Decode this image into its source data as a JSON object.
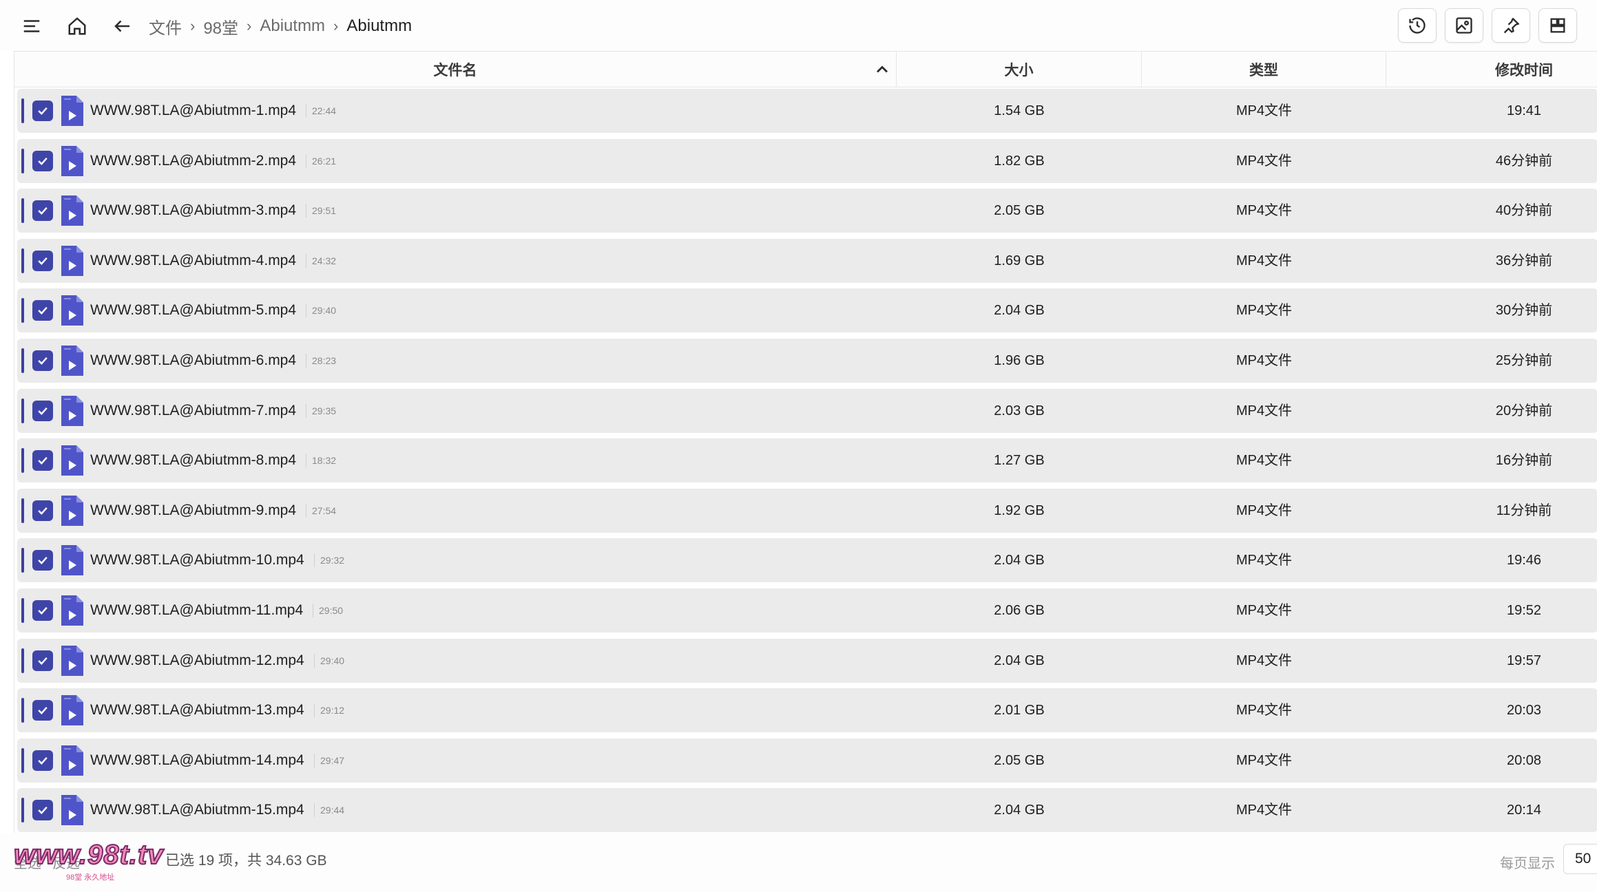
{
  "breadcrumb": {
    "items": [
      "文件",
      "98堂",
      "Abiutmm",
      "Abiutmm"
    ]
  },
  "icons": {
    "menu": "hamburger-menu-icon",
    "home": "home-icon",
    "back": "arrow-left-icon",
    "history": "history-icon",
    "image": "image-icon",
    "pin": "pin-icon",
    "layout": "layout-grid-icon"
  },
  "colors": {
    "checkbox": "#3f45a8",
    "row_bg": "#ebebeb",
    "file_icon": "#4f55c9"
  },
  "table": {
    "columns": {
      "name": "文件名",
      "size": "大小",
      "type": "类型",
      "time": "修改时间"
    },
    "sort": {
      "column": "name",
      "direction": "asc"
    },
    "rows": [
      {
        "name": "WWW.98T.LA@Abiutmm-1.mp4",
        "duration": "22:44",
        "size": "1.54 GB",
        "type": "MP4文件",
        "time": "19:41",
        "checked": true
      },
      {
        "name": "WWW.98T.LA@Abiutmm-2.mp4",
        "duration": "26:21",
        "size": "1.82 GB",
        "type": "MP4文件",
        "time": "46分钟前",
        "checked": true
      },
      {
        "name": "WWW.98T.LA@Abiutmm-3.mp4",
        "duration": "29:51",
        "size": "2.05 GB",
        "type": "MP4文件",
        "time": "40分钟前",
        "checked": true
      },
      {
        "name": "WWW.98T.LA@Abiutmm-4.mp4",
        "duration": "24:32",
        "size": "1.69 GB",
        "type": "MP4文件",
        "time": "36分钟前",
        "checked": true
      },
      {
        "name": "WWW.98T.LA@Abiutmm-5.mp4",
        "duration": "29:40",
        "size": "2.04 GB",
        "type": "MP4文件",
        "time": "30分钟前",
        "checked": true
      },
      {
        "name": "WWW.98T.LA@Abiutmm-6.mp4",
        "duration": "28:23",
        "size": "1.96 GB",
        "type": "MP4文件",
        "time": "25分钟前",
        "checked": true
      },
      {
        "name": "WWW.98T.LA@Abiutmm-7.mp4",
        "duration": "29:35",
        "size": "2.03 GB",
        "type": "MP4文件",
        "time": "20分钟前",
        "checked": true
      },
      {
        "name": "WWW.98T.LA@Abiutmm-8.mp4",
        "duration": "18:32",
        "size": "1.27 GB",
        "type": "MP4文件",
        "time": "16分钟前",
        "checked": true
      },
      {
        "name": "WWW.98T.LA@Abiutmm-9.mp4",
        "duration": "27:54",
        "size": "1.92 GB",
        "type": "MP4文件",
        "time": "11分钟前",
        "checked": true
      },
      {
        "name": "WWW.98T.LA@Abiutmm-10.mp4",
        "duration": "29:32",
        "size": "2.04 GB",
        "type": "MP4文件",
        "time": "19:46",
        "checked": true
      },
      {
        "name": "WWW.98T.LA@Abiutmm-11.mp4",
        "duration": "29:50",
        "size": "2.06 GB",
        "type": "MP4文件",
        "time": "19:52",
        "checked": true
      },
      {
        "name": "WWW.98T.LA@Abiutmm-12.mp4",
        "duration": "29:40",
        "size": "2.04 GB",
        "type": "MP4文件",
        "time": "19:57",
        "checked": true
      },
      {
        "name": "WWW.98T.LA@Abiutmm-13.mp4",
        "duration": "29:12",
        "size": "2.01 GB",
        "type": "MP4文件",
        "time": "20:03",
        "checked": true
      },
      {
        "name": "WWW.98T.LA@Abiutmm-14.mp4",
        "duration": "29:47",
        "size": "2.05 GB",
        "type": "MP4文件",
        "time": "20:08",
        "checked": true
      },
      {
        "name": "WWW.98T.LA@Abiutmm-15.mp4",
        "duration": "29:44",
        "size": "2.04 GB",
        "type": "MP4文件",
        "time": "20:14",
        "checked": true
      }
    ]
  },
  "footer": {
    "select_all": "全选",
    "invert": "反选",
    "summary": "已选 19 项，共 34.63 GB",
    "per_page_label": "每页显示",
    "per_page_value": "50",
    "watermark": "www.98t.tv",
    "watermark_sub": "98堂 永久地址"
  }
}
